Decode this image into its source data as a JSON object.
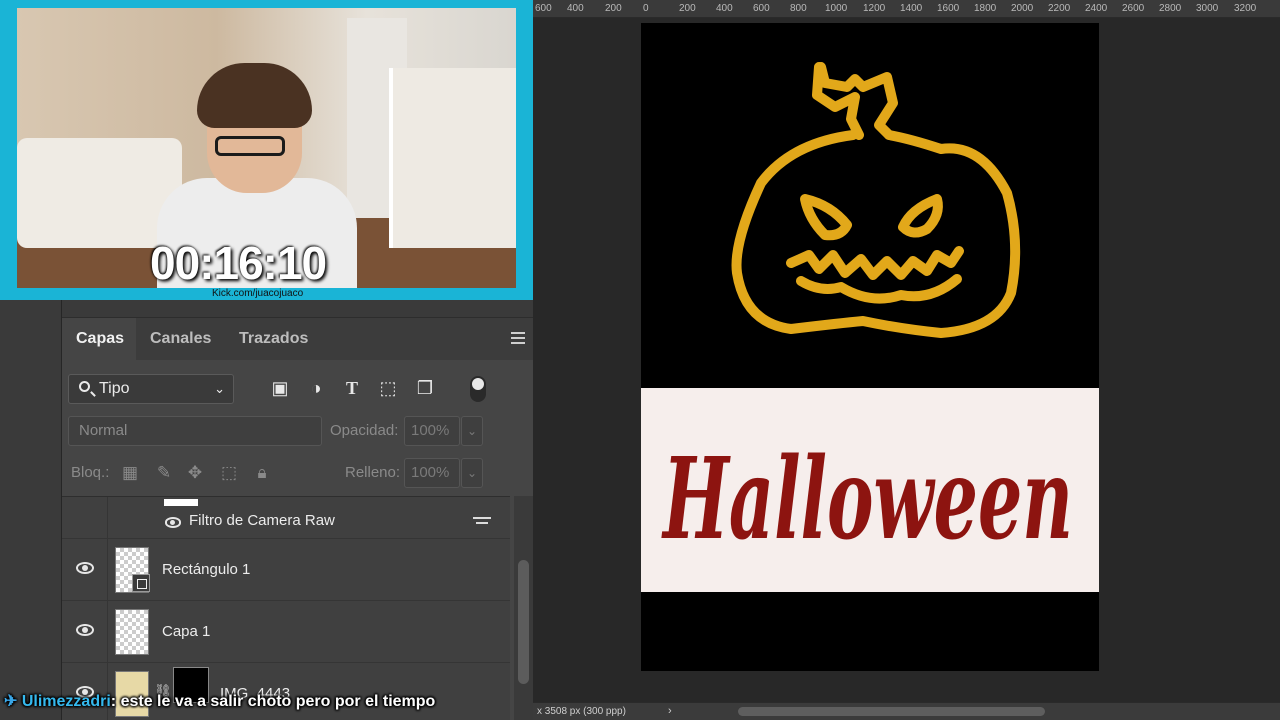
{
  "webcam": {
    "timer": "00:16:10",
    "channel_tag": "Kick.com/juacojuaco"
  },
  "ruler": {
    "labels": [
      "600",
      "400",
      "200",
      "0",
      "200",
      "400",
      "600",
      "800",
      "1000",
      "1200",
      "1400",
      "1600",
      "1800",
      "2000",
      "2200",
      "2400",
      "2600",
      "2800",
      "3000",
      "3200"
    ]
  },
  "canvas": {
    "halloween_text": "Halloween",
    "artboard_color": "#000000",
    "band_color": "#f6eeec",
    "pumpkin_color": "#e2a81a",
    "text_color": "#8d1410"
  },
  "statusbar": {
    "doc_info": "x 3508 px (300 ppp)",
    "arrow": "›"
  },
  "layers_panel": {
    "tabs": [
      {
        "label": "Capas",
        "active": true
      },
      {
        "label": "Canales",
        "active": false
      },
      {
        "label": "Trazados",
        "active": false
      }
    ],
    "filter": {
      "value": "Tipo",
      "icons": [
        "image-filter-icon",
        "adjustment-filter-icon",
        "type-filter-icon",
        "shape-filter-icon",
        "smart-object-filter-icon"
      ]
    },
    "blend_mode": "Normal",
    "opacity_label": "Opacidad:",
    "opacity_value": "100%",
    "lock_label": "Bloq.:",
    "fill_label": "Relleno:",
    "fill_value": "100%",
    "layers": [
      {
        "name": "Filtro de Camera Raw",
        "type": "smart-filter"
      },
      {
        "name": "Rectángulo 1",
        "type": "shape",
        "visible": true
      },
      {
        "name": "Capa 1",
        "type": "pixel",
        "visible": true
      },
      {
        "name": "IMG_4443",
        "type": "smart-object",
        "visible": true
      }
    ]
  },
  "chat": {
    "user": "Ulimezzadri",
    "message": "este le va a salir choto pero por el tiempo"
  }
}
